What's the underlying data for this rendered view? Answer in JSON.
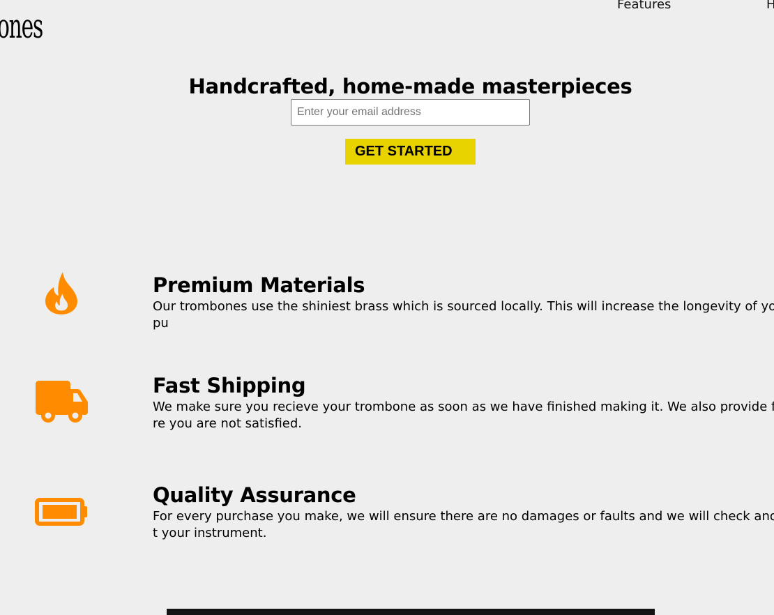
{
  "header": {
    "logo_text": "ones",
    "nav": [
      {
        "label": "Features"
      },
      {
        "label": "H"
      }
    ]
  },
  "hero": {
    "title": "Handcrafted, home-made masterpieces",
    "email_placeholder": "Enter your email address",
    "cta_label": "GET STARTED"
  },
  "features": [
    {
      "icon": "fire-icon",
      "title": "Premium Materials",
      "description": "Our trombones use the shiniest brass which is sourced locally. This will increase the longevity of your pu"
    },
    {
      "icon": "truck-icon",
      "title": "Fast Shipping",
      "description": "We make sure you recieve your trombone as soon as we have finished making it. We also provide free re you are not satisfied."
    },
    {
      "icon": "battery-icon",
      "title": "Quality Assurance",
      "description": "For every purchase you make, we will ensure there are no damages or faults and we will check and test t your instrument."
    }
  ],
  "colors": {
    "background": "#eeeeee",
    "accent_icon": "#ff8c00",
    "cta_background": "#e8d200"
  }
}
